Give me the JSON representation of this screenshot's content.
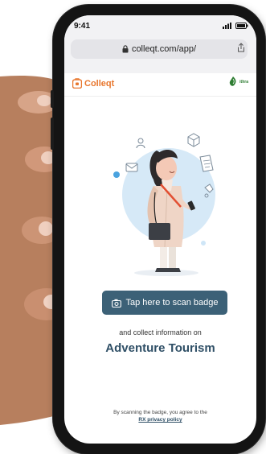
{
  "status": {
    "time": "9:41"
  },
  "browser": {
    "url": "colleqt.com/app/"
  },
  "header": {
    "brand": "Colleqt",
    "partner_name": "ithra"
  },
  "main": {
    "scan_button_label": "Tap here to scan badge",
    "collect_text": "and collect information on",
    "topic": "Adventure Tourism"
  },
  "footer": {
    "agreement_text": "By scanning the badge, you agree to the",
    "privacy_link": "RX privacy policy"
  },
  "colors": {
    "accent": "#e8772e",
    "button_bg": "#3c6177",
    "topic_text": "#2f4f66"
  },
  "icons": {
    "lock": "lock-icon",
    "share": "share-icon",
    "camera": "camera-icon",
    "signal": "signal-icon",
    "battery": "battery-icon"
  }
}
